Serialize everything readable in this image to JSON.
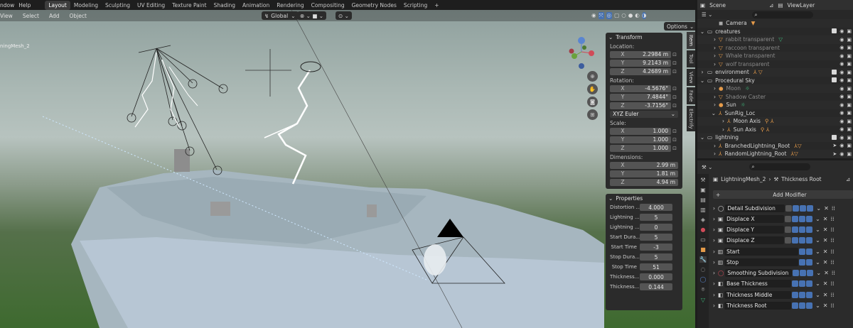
{
  "top_menu": [
    "ndow",
    "Help"
  ],
  "workspaces": [
    "Layout",
    "Modeling",
    "Sculpting",
    "UV Editing",
    "Texture Paint",
    "Shading",
    "Animation",
    "Rendering",
    "Compositing",
    "Geometry Nodes",
    "Scripting",
    "+"
  ],
  "scene": {
    "label": "Scene",
    "view_layer": "ViewLayer"
  },
  "viewport_menu": [
    "View",
    "Select",
    "Add",
    "Object"
  ],
  "viewport_header": {
    "orientation": "Global",
    "options": "Options"
  },
  "object_label": "ningMesh_2",
  "side_tabs": [
    "Item",
    "Tool",
    "View",
    "Fade",
    "Electrify"
  ],
  "transform": {
    "title": "Transform",
    "location_label": "Location:",
    "location": [
      {
        "ax": "X",
        "v": "2.2984 m"
      },
      {
        "ax": "Y",
        "v": "9.2143 m"
      },
      {
        "ax": "Z",
        "v": "4.2689 m"
      }
    ],
    "rotation_label": "Rotation:",
    "rotation": [
      {
        "ax": "X",
        "v": "-4.5676°"
      },
      {
        "ax": "Y",
        "v": "7.4844°"
      },
      {
        "ax": "Z",
        "v": "-3.7156°"
      }
    ],
    "rotation_mode": "XYZ Euler",
    "scale_label": "Scale:",
    "scale": [
      {
        "ax": "X",
        "v": "1.000"
      },
      {
        "ax": "Y",
        "v": "1.000"
      },
      {
        "ax": "Z",
        "v": "1.000"
      }
    ],
    "dimensions_label": "Dimensions:",
    "dimensions": [
      {
        "ax": "X",
        "v": "2.99 m"
      },
      {
        "ax": "Y",
        "v": "1.81 m"
      },
      {
        "ax": "Z",
        "v": "4.94 m"
      }
    ]
  },
  "properties_panel": {
    "title": "Properties",
    "rows": [
      {
        "label": "Distortion ...",
        "value": "4.000"
      },
      {
        "label": "Lightning ...",
        "value": "5"
      },
      {
        "label": "Lightning ...",
        "value": "0"
      },
      {
        "label": "Start Dura...",
        "value": "5"
      },
      {
        "label": "Start Time",
        "value": "-3"
      },
      {
        "label": "Stop Dura...",
        "value": "5"
      },
      {
        "label": "Stop Time",
        "value": "51"
      },
      {
        "label": "Thickness...",
        "value": "0.000"
      },
      {
        "label": "Thickness...",
        "value": "0.144"
      }
    ]
  },
  "outliner": [
    {
      "name": "Camera",
      "dim": false
    },
    {
      "name": "creatures",
      "dim": false
    },
    {
      "name": "rabbit transparent",
      "dim": true
    },
    {
      "name": "raccoon transparent",
      "dim": true
    },
    {
      "name": "Whale transparent",
      "dim": true
    },
    {
      "name": "wolf transparent",
      "dim": true
    },
    {
      "name": "environment",
      "dim": false
    },
    {
      "name": "Procedural Sky",
      "dim": false
    },
    {
      "name": "Moon",
      "dim": true
    },
    {
      "name": "Shadow Caster",
      "dim": true
    },
    {
      "name": "Sun",
      "dim": false
    },
    {
      "name": "SunRig_Loc",
      "dim": false
    },
    {
      "name": "Moon Axis",
      "dim": false
    },
    {
      "name": "Sun Axis",
      "dim": false
    },
    {
      "name": "lightning",
      "dim": false
    },
    {
      "name": "BranchedLightning_Root",
      "dim": false
    },
    {
      "name": "RandomLightning_Root",
      "dim": false
    }
  ],
  "properties_editor": {
    "object": "LightningMesh_2",
    "modifier": "Thickness Root",
    "add_modifier": "Add Modifier",
    "modifiers": [
      "Detail Subdivision",
      "Displace X",
      "Displace Y",
      "Displace Z",
      "Start",
      "Stop",
      "Smoothing Subdivision",
      "Base Thickness",
      "Thickness Middle",
      "Thickness Root"
    ]
  },
  "colors": {
    "accent": "#4772b3",
    "active_workspace": "#3d3d3d"
  }
}
